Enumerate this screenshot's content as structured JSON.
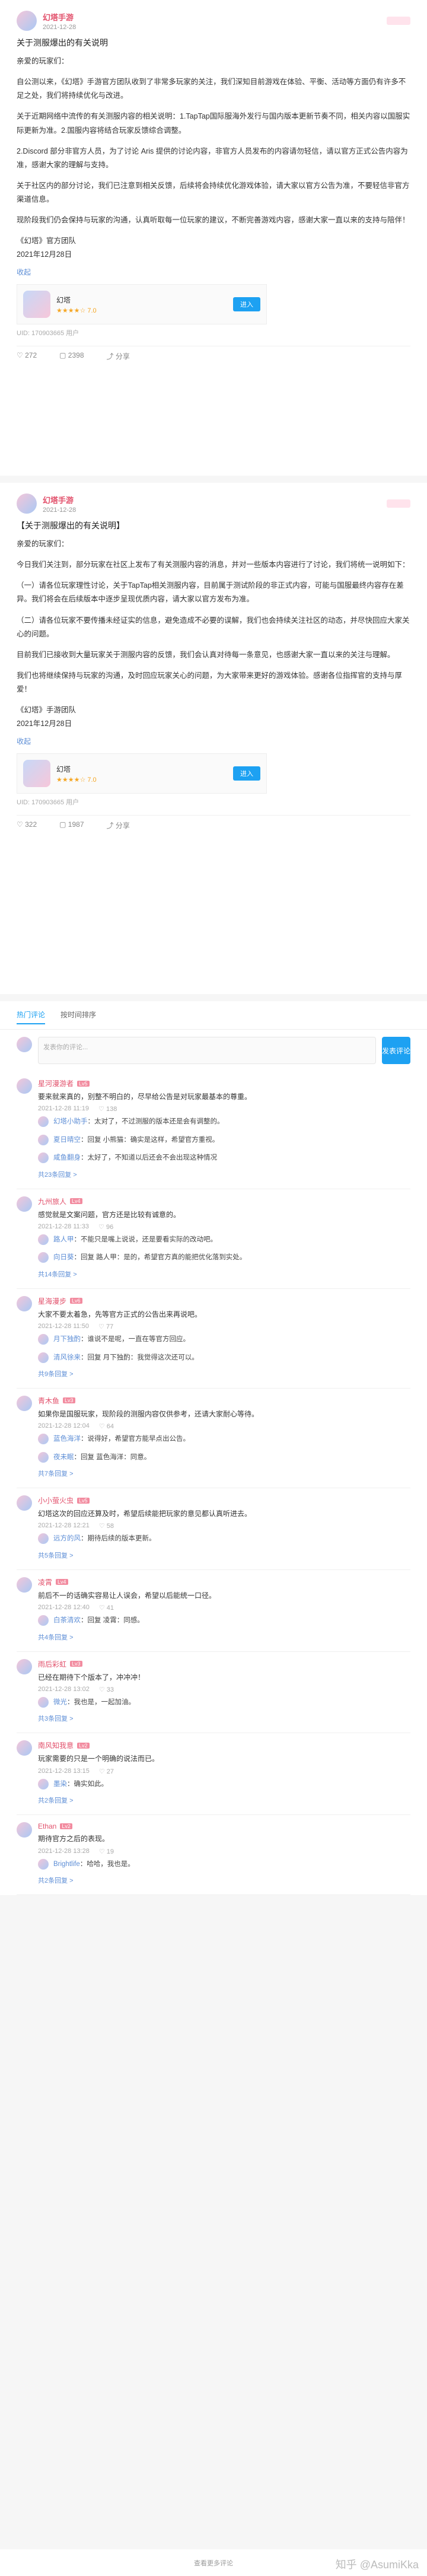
{
  "post1": {
    "author": "幻塔手游",
    "time": "2021-12-28",
    "title": "关于测服爆出的有关说明",
    "greeting": "亲爱的玩家们：",
    "paragraphs": [
      "自公测以来，《幻塔》手游官方团队收到了非常多玩家的关注，我们深知目前游戏在体验、平衡、活动等方面仍有许多不足之处，我们将持续优化与改进。",
      "关于近期网络中流传的有关测服内容的相关说明：1.TapTap国际服海外发行与国内版本更新节奏不同，相关内容以国服实际更新为准。2.国服内容将结合玩家反馈综合调整。",
      "2.Discord 部分非官方人员，为了讨论 Aris 提供的讨论内容，非官方人员发布的内容请勿轻信，请以官方正式公告内容为准，感谢大家的理解与支持。",
      "关于社区内的部分讨论，我们已注意到相关反馈，后续将会持续优化游戏体验，请大家以官方公告为准，不要轻信非官方渠道信息。",
      "现阶段我们仍会保持与玩家的沟通，认真听取每一位玩家的建议，不断完善游戏内容，感谢大家一直以来的支持与陪伴！"
    ],
    "sign1": "《幻塔》官方团队",
    "sign2": "2021年12月28日",
    "link": "收起",
    "game_name": "幻塔",
    "game_stars": "★★★★☆ 7.0",
    "enter": "进入",
    "uid": "UID: 170903665 用户",
    "likes": "272",
    "comments": "2398",
    "shares": "分享"
  },
  "post2": {
    "author": "幻塔手游",
    "time": "2021-12-28",
    "title": "【关于测服爆出的有关说明】",
    "greeting": "亲爱的玩家们：",
    "paragraphs": [
      "今日我们关注到，部分玩家在社区上发布了有关测服内容的消息，并对一些版本内容进行了讨论，我们将统一说明如下：",
      "（一）请各位玩家理性讨论，关于TapTap相关测服内容，目前属于测试阶段的非正式内容，可能与国服最终内容存在差异。我们将会在后续版本中逐步呈现优质内容，请大家以官方发布为准。",
      "（二）请各位玩家不要传播未经证实的信息，避免造成不必要的误解，我们也会持续关注社区的动态，并尽快回应大家关心的问题。",
      "目前我们已接收到大量玩家关于测服内容的反馈，我们会认真对待每一条意见，也感谢大家一直以来的关注与理解。",
      "我们也将继续保持与玩家的沟通，及时回应玩家关心的问题，为大家带来更好的游戏体验。感谢各位指挥官的支持与厚爱！"
    ],
    "sign1": "《幻塔》手游团队",
    "sign2": "2021年12月28日",
    "link": "收起",
    "game_name": "幻塔",
    "game_stars": "★★★★☆ 7.0",
    "enter": "进入",
    "uid": "UID: 170903665 用户",
    "likes": "322",
    "comments": "1987",
    "shares": "分享"
  },
  "tabs": [
    "热门评论",
    "按时间排序"
  ],
  "composer": {
    "placeholder": "发表你的评论...",
    "button": "发表评论"
  },
  "comments": [
    {
      "name": "星河漫游者",
      "lv": "Lv5",
      "text": "要来就来真的，别整不明白的，尽早给公告是对玩家最基本的尊重。",
      "time": "2021-12-28 11:19",
      "likes": "138",
      "replies": [
        {
          "name": "幻塔小助手",
          "text": "太对了，不过测服的版本还是会有调整的。"
        },
        {
          "name": "夏日晴空",
          "text": "回复 小熊猫：确实是这样，希望官方重视。"
        },
        {
          "name": "咸鱼翻身",
          "text": "太好了，不知道以后还会不会出现这种情况"
        }
      ],
      "more": "共23条回复 >"
    },
    {
      "name": "九州旅人",
      "lv": "Lv4",
      "text": "感觉就是文案问题，官方还是比较有诚意的。",
      "time": "2021-12-28 11:33",
      "likes": "96",
      "replies": [
        {
          "name": "路人甲",
          "text": "不能只是嘴上说说，还是要看实际的改动吧。"
        },
        {
          "name": "向日葵",
          "text": "回复 路人甲：是的，希望官方真的能把优化落到实处。"
        }
      ],
      "more": "共14条回复 >"
    },
    {
      "name": "星海漫步",
      "lv": "Lv6",
      "text": "大家不要太着急，先等官方正式的公告出来再说吧。",
      "time": "2021-12-28 11:50",
      "likes": "77",
      "replies": [
        {
          "name": "月下独酌",
          "text": "谁说不是呢，一直在等官方回应。"
        },
        {
          "name": "清风徐来",
          "text": "回复 月下独酌：我觉得这次还可以。"
        }
      ],
      "more": "共9条回复 >"
    },
    {
      "name": "青木鱼",
      "lv": "Lv3",
      "text": "如果你是国服玩家，现阶段的测服内容仅供参考，还请大家耐心等待。",
      "time": "2021-12-28 12:04",
      "likes": "64",
      "replies": [
        {
          "name": "蓝色海洋",
          "text": "说得好，希望官方能早点出公告。"
        },
        {
          "name": "夜未眠",
          "text": "回复 蓝色海洋：同意。"
        }
      ],
      "more": "共7条回复 >"
    },
    {
      "name": "小小萤火虫",
      "lv": "Lv5",
      "text": "幻塔这次的回应还算及时，希望后续能把玩家的意见都认真听进去。",
      "time": "2021-12-28 12:21",
      "likes": "58",
      "replies": [
        {
          "name": "远方的风",
          "text": "期待后续的版本更新。"
        }
      ],
      "more": "共5条回复 >"
    },
    {
      "name": "凌霄",
      "lv": "Lv4",
      "text": "前后不一的话确实容易让人误会，希望以后能统一口径。",
      "time": "2021-12-28 12:40",
      "likes": "41",
      "replies": [
        {
          "name": "白茶清欢",
          "text": "回复 凌霄：同感。"
        }
      ],
      "more": "共4条回复 >"
    },
    {
      "name": "雨后彩虹",
      "lv": "Lv3",
      "text": "已经在期待下个版本了，冲冲冲！",
      "time": "2021-12-28 13:02",
      "likes": "33",
      "replies": [
        {
          "name": "微光",
          "text": "我也是，一起加油。"
        }
      ],
      "more": "共3条回复 >"
    },
    {
      "name": "南风知我意",
      "lv": "Lv2",
      "text": "玩家需要的只是一个明确的说法而已。",
      "time": "2021-12-28 13:15",
      "likes": "27",
      "replies": [
        {
          "name": "墨染",
          "text": "确实如此。"
        }
      ],
      "more": "共2条回复 >"
    },
    {
      "name": "Ethan",
      "lv": "Lv2",
      "text": "期待官方之后的表现。",
      "time": "2021-12-28 13:28",
      "likes": "19",
      "replies": [
        {
          "name": "Brightlife",
          "text": "哈哈，我也是。"
        }
      ],
      "more": "共2条回复 >"
    }
  ],
  "footer": "查看更多评论",
  "watermark": "知乎 @AsumiKka"
}
